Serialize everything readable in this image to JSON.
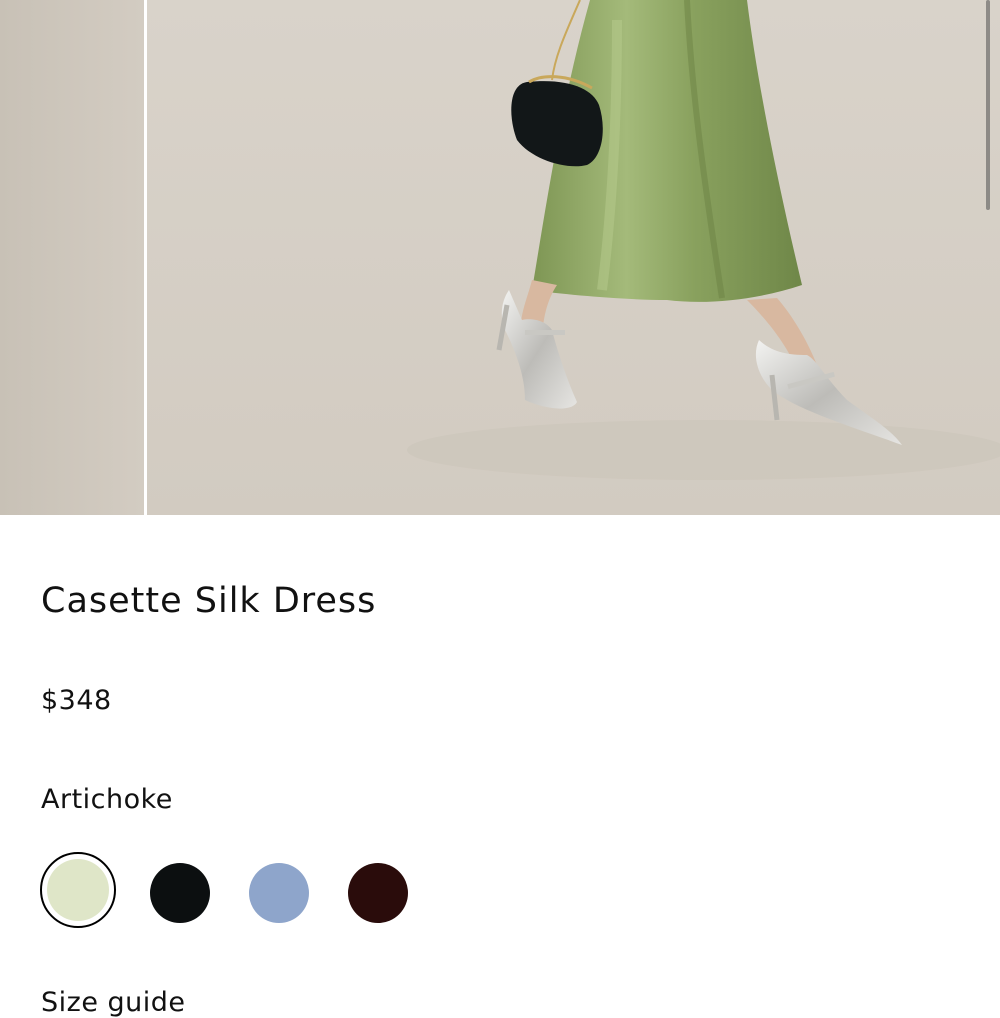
{
  "product": {
    "name": "Casette Silk Dress",
    "price": "$348",
    "selected_color": "Artichoke",
    "size_guide_label": "Size guide"
  },
  "swatches": [
    {
      "name": "artichoke",
      "color": "#dfe6c8",
      "selected": true
    },
    {
      "name": "black",
      "color": "#0c0f10",
      "selected": false
    },
    {
      "name": "blue",
      "color": "#8ea5cb",
      "selected": false
    },
    {
      "name": "chocolate",
      "color": "#2a0c0b",
      "selected": false
    }
  ],
  "colors": {
    "background": "#ffffff",
    "text": "#111111",
    "photo_backdrop": "#d6d0c7",
    "dress": "#8fa865"
  }
}
